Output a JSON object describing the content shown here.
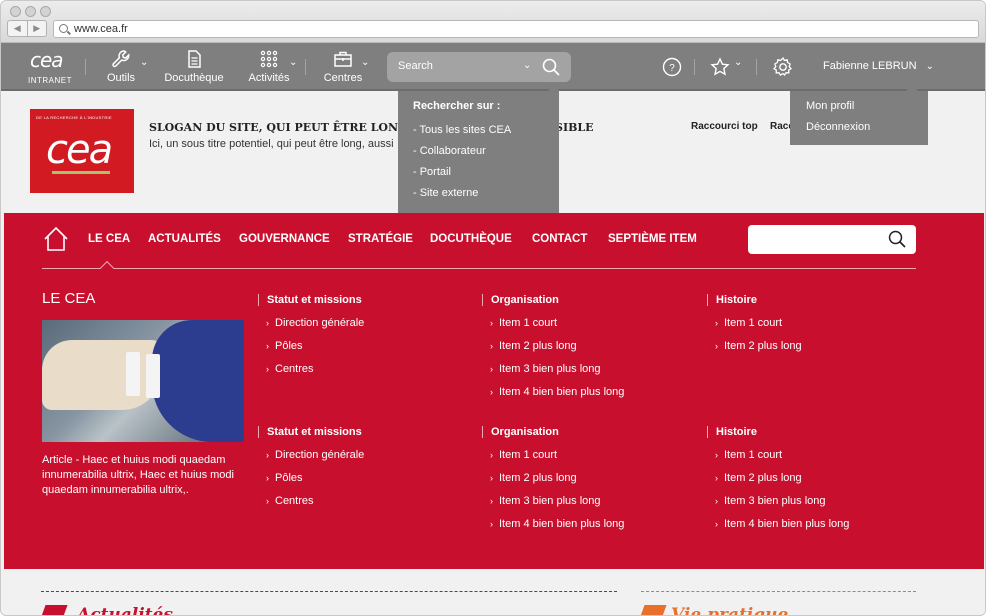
{
  "browser": {
    "url": "www.cea.fr"
  },
  "topbar": {
    "logo_word": "cea",
    "logo_sub": "INTRANET",
    "items": [
      {
        "label": "Outils",
        "icon": "wrench-icon"
      },
      {
        "label": "Docuthèque",
        "icon": "document-icon"
      },
      {
        "label": "Activités",
        "icon": "grid-icon"
      },
      {
        "label": "Centres",
        "icon": "briefcase-icon"
      }
    ],
    "search_placeholder": "Search",
    "user_name": "Fabienne LEBRUN"
  },
  "search_dropdown": {
    "title": "Rechercher sur :",
    "options": [
      "- Tous les sites CEA",
      "- Collaborateur",
      "- Portail",
      "- Site externe"
    ]
  },
  "user_dropdown": {
    "options": [
      "Mon profil",
      "Déconnexion"
    ]
  },
  "header": {
    "logo_tagline": "DE LA RECHERCHE À L'INDUSTRIE",
    "logo_word": "cea",
    "slogan": "SLOGAN DU SITE, QUI PEUT ÊTRE LONG, AUSSI LONG QUE POSSIBLE",
    "subtitle": "Ici, un sous titre potentiel, qui peut être long, aussi",
    "shortcuts": [
      "Raccourci top",
      "Raccourci top"
    ]
  },
  "nav": {
    "links": [
      "LE CEA",
      "ACTUALITÉS",
      "GOUVERNANCE",
      "STRATÉGIE",
      "DOCUTHÈQUE",
      "CONTACT",
      "SEPTIÈME ITEM"
    ],
    "search_placeholder": ""
  },
  "mega": {
    "title": "LE CEA",
    "article": "Article - Haec et huius modi quaedam innumerabilia ultrix, Haec et huius modi quaedam innumerabilia ultrix,.",
    "rows": [
      [
        {
          "head": "Statut et missions",
          "items": [
            "Direction générale",
            "Pôles",
            "Centres"
          ]
        },
        {
          "head": "Organisation",
          "items": [
            "Item 1 court",
            "Item 2 plus long",
            "Item 3 bien plus long",
            "Item 4 bien bien plus long"
          ]
        },
        {
          "head": "Histoire",
          "items": [
            "Item 1 court",
            "Item 2 plus long"
          ]
        }
      ],
      [
        {
          "head": "Statut et missions",
          "items": [
            "Direction générale",
            "Pôles",
            "Centres"
          ]
        },
        {
          "head": "Organisation",
          "items": [
            "Item 1 court",
            "Item 2 plus long",
            "Item 3 bien plus long",
            "Item 4 bien bien plus long"
          ]
        },
        {
          "head": "Histoire",
          "items": [
            "Item 1 court",
            "Item 2 plus long",
            "Item 3 bien plus long",
            "Item 4 bien bien plus long"
          ]
        }
      ]
    ]
  },
  "bottom": {
    "left_title": "Actualités",
    "right_title": "Vie pratique"
  },
  "colors": {
    "brand_red": "#c8102e",
    "toolbar_gray": "#7f7f7f",
    "accent_orange": "#e8702a"
  }
}
